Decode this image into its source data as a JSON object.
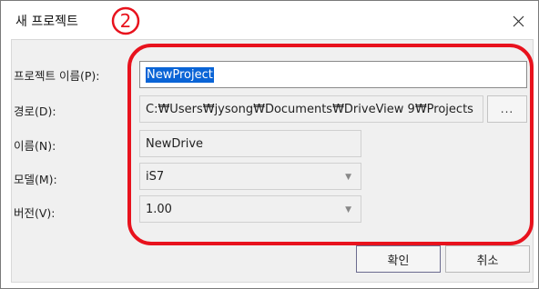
{
  "window": {
    "title": "새 프로젝트",
    "close_icon": "close-icon"
  },
  "annotation": {
    "number": "2",
    "color": "#e8121d"
  },
  "form": {
    "project_name": {
      "label": "프로젝트 이름(P):",
      "value": "NewProject"
    },
    "path": {
      "label": "경로(D):",
      "value": "C:₩Users₩jysong₩Documents₩DriveView 9₩Projects",
      "browse_label": "..."
    },
    "name": {
      "label": "이름(N):",
      "value": "NewDrive"
    },
    "model": {
      "label": "모델(M):",
      "value": "iS7"
    },
    "version": {
      "label": "버전(V):",
      "value": "1.00"
    }
  },
  "buttons": {
    "ok": "확인",
    "cancel": "취소"
  },
  "colors": {
    "selection": "#0a64d6",
    "panel": "#f0f0f0"
  }
}
